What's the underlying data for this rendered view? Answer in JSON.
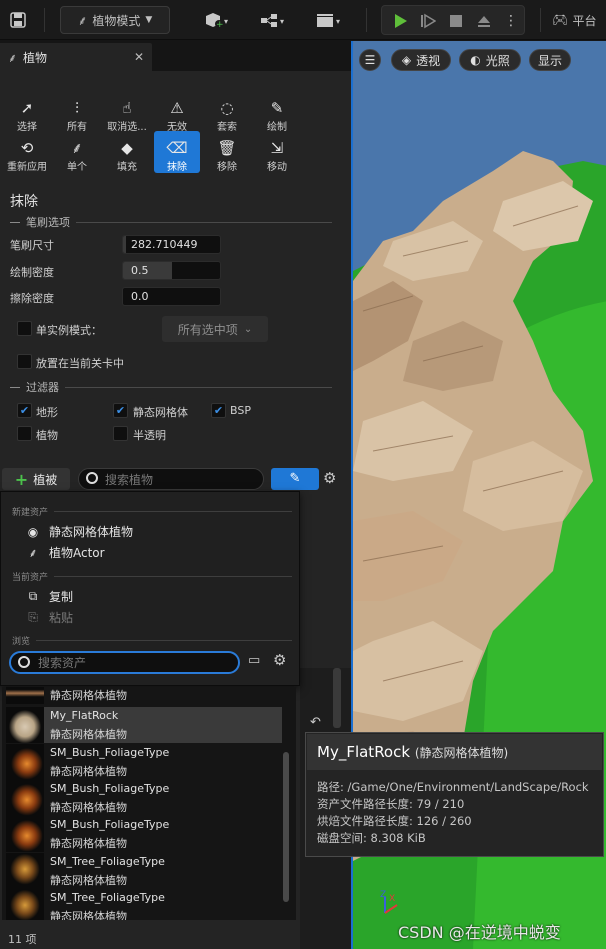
{
  "toolbar": {
    "mode_label": "植物模式",
    "platform_label": "平台"
  },
  "panel": {
    "tab_title": "植物",
    "tools": [
      {
        "label": "选择",
        "icon": "cursor-icon"
      },
      {
        "label": "所有",
        "icon": "select-all-icon"
      },
      {
        "label": "取消选...",
        "icon": "deselect-icon"
      },
      {
        "label": "无效",
        "icon": "invalid-icon"
      },
      {
        "label": "套索",
        "icon": "lasso-icon"
      },
      {
        "label": "绘制",
        "icon": "brush-icon"
      },
      {
        "label": "重新应用",
        "icon": "reapply-icon"
      },
      {
        "label": "单个",
        "icon": "single-icon"
      },
      {
        "label": "填充",
        "icon": "fill-icon"
      },
      {
        "label": "抹除",
        "icon": "erase-icon"
      },
      {
        "label": "移除",
        "icon": "remove-icon"
      },
      {
        "label": "移动",
        "icon": "move-icon"
      }
    ],
    "active_tool": "抹除",
    "section_title": "抹除",
    "brush_options_header": "笔刷选项",
    "brush_size_label": "笔刷尺寸",
    "brush_size_value": "282.710449",
    "paint_density_label": "绘制密度",
    "paint_density_value": "0.5",
    "paint_density_fraction": 0.5,
    "erase_density_label": "擦除密度",
    "erase_density_value": "0.0",
    "single_instance_label": "单实例模式：",
    "single_instance_dropdown": "所有选中项",
    "place_in_level_label": "放置在当前关卡中",
    "filters_header": "过滤器",
    "filters": [
      {
        "label": "地形",
        "checked": true
      },
      {
        "label": "静态网格体",
        "checked": true
      },
      {
        "label": "BSP",
        "checked": true
      },
      {
        "label": "植物",
        "checked": false
      },
      {
        "label": "半透明",
        "checked": false
      }
    ],
    "add_button_label": "植被",
    "search_placeholder": "搜索植物"
  },
  "popup": {
    "new_asset_header": "新建资产",
    "new_items": [
      "静态网格体植物",
      "植物Actor"
    ],
    "current_asset_header": "当前资产",
    "copy_label": "复制",
    "paste_label": "粘贴",
    "browse_header": "浏览",
    "asset_search_placeholder": "搜索资产"
  },
  "asset_list": {
    "rows": [
      {
        "name": "",
        "type": "静态网格体植物"
      },
      {
        "name": "My_FlatRock",
        "type": "静态网格体植物"
      },
      {
        "name": "SM_Bush_FoliageType",
        "type": "静态网格体植物"
      },
      {
        "name": "SM_Bush_FoliageType",
        "type": "静态网格体植物"
      },
      {
        "name": "SM_Bush_FoliageType",
        "type": "静态网格体植物"
      },
      {
        "name": "SM_Tree_FoliageType",
        "type": "静态网格体植物"
      },
      {
        "name": "SM_Tree_FoliageType",
        "type": "静态网格体植物"
      }
    ],
    "count": "11 项"
  },
  "viewport": {
    "perspective": "透视",
    "lighting": "光照",
    "show": "显示"
  },
  "tooltip": {
    "name": "My_FlatRock",
    "type": "(静态网格体植物)",
    "path": "路径: /Game/One/Environment/LandScape/Rock",
    "asset_path_len": "资产文件路径长度: 79 / 210",
    "cooked_path_len": "烘焙文件路径长度: 126 / 260",
    "disk_space": "磁盘空间: 8.308 KiB"
  },
  "watermark": "CSDN @在逆境中蜕变"
}
